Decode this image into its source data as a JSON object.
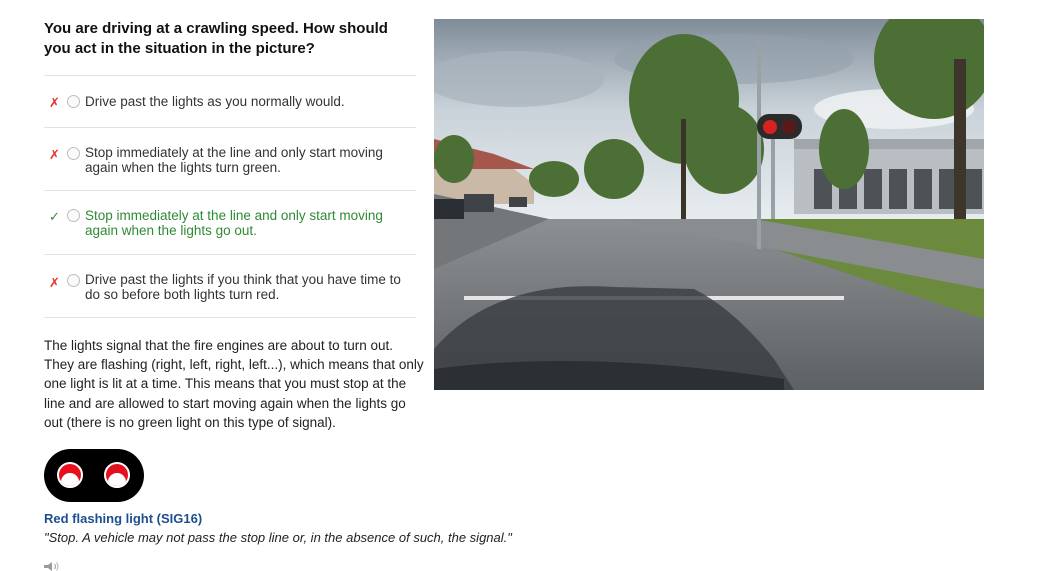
{
  "question": "You are driving at a crawling speed. How should you act in the situation in the picture?",
  "options": [
    {
      "mark": "✗",
      "status": "incorrect",
      "text": "Drive past the lights as you normally would."
    },
    {
      "mark": "✗",
      "status": "incorrect",
      "text": "Stop immediately at the line and only start moving again when the lights turn green."
    },
    {
      "mark": "✓",
      "status": "correct",
      "text": "Stop immediately at the line and only start moving again when the lights go out."
    },
    {
      "mark": "✗",
      "status": "incorrect",
      "text": "Drive past the lights if you think that you have time to do so before both lights turn red."
    }
  ],
  "explanation": "The lights signal that the fire engines are about to turn out. They are flashing (right, left, right, left...), which means that only one light is lit at a time. This means that you must stop at the line and are allowed to start moving again when the lights go out (there is no green light on this type of signal).",
  "signal": {
    "title": "Red flashing light (SIG16)",
    "quote": "\"Stop. A vehicle may not pass the stop line or, in the absence of such, the signal.\""
  },
  "colors": {
    "wrong": "#e0312f",
    "correct": "#2f8a35",
    "link": "#1d4e8f",
    "signal_red": "#e5101e"
  },
  "icons": {
    "audio": "speaker-icon"
  }
}
